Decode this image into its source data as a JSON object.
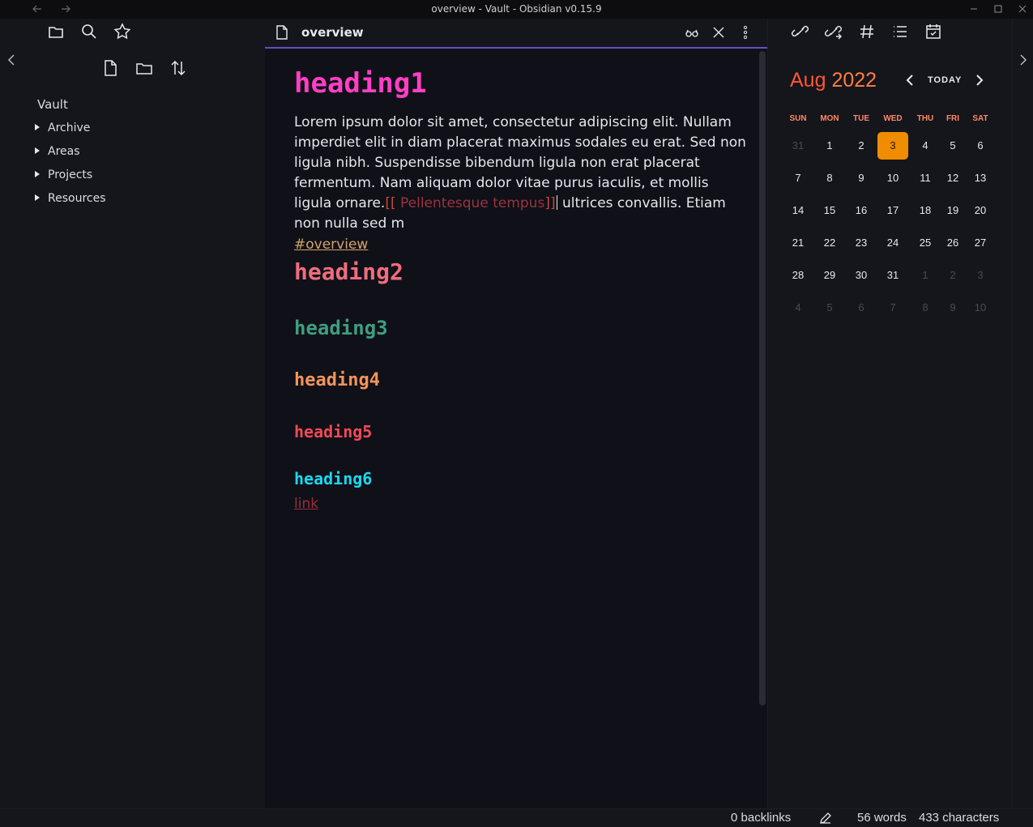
{
  "window": {
    "title": "overview - Vault - Obsidian v0.15.9"
  },
  "sidebar": {
    "vault_name": "Vault",
    "folders": [
      {
        "label": "Archive"
      },
      {
        "label": "Areas"
      },
      {
        "label": "Projects"
      },
      {
        "label": "Resources"
      }
    ]
  },
  "editor": {
    "tab_title": "overview",
    "heading1": "heading1",
    "paragraph_before": "Lorem ipsum dolor sit amet, consectetur adipiscing elit. Nullam imperdiet elit in diam placerat maximus sodales eu erat. Sed non ligula nibh. Suspendisse bibendum ligula non erat placerat fermentum. Nam aliquam dolor vitae purus iaculis, et mollis ligula ornare.",
    "wikilink_open": "[[",
    "wikilink_text": " Pellentesque tempus",
    "wikilink_close": "]]",
    "paragraph_after": " ultrices convallis. Etiam non nulla sed m",
    "tag": "#overview",
    "heading2": "heading2",
    "heading3": "heading3",
    "heading4": "heading4",
    "heading5": "heading5",
    "heading6": "heading6",
    "link": "link"
  },
  "calendar": {
    "month": "Aug",
    "year": "2022",
    "today_label": "TODAY",
    "weekdays": [
      "SUN",
      "MON",
      "TUE",
      "WED",
      "THU",
      "FRI",
      "SAT"
    ],
    "weeks": [
      [
        "31",
        "1",
        "2",
        "3",
        "4",
        "5",
        "6"
      ],
      [
        "7",
        "8",
        "9",
        "10",
        "11",
        "12",
        "13"
      ],
      [
        "14",
        "15",
        "16",
        "17",
        "18",
        "19",
        "20"
      ],
      [
        "21",
        "22",
        "23",
        "24",
        "25",
        "26",
        "27"
      ],
      [
        "28",
        "29",
        "30",
        "31",
        "1",
        "2",
        "3"
      ],
      [
        "4",
        "5",
        "6",
        "7",
        "8",
        "9",
        "10"
      ]
    ],
    "outside_month": [
      [
        0,
        0
      ],
      [
        4,
        4
      ],
      [
        4,
        5
      ],
      [
        4,
        6
      ],
      [
        5,
        0
      ],
      [
        5,
        1
      ],
      [
        5,
        2
      ],
      [
        5,
        3
      ],
      [
        5,
        4
      ],
      [
        5,
        5
      ],
      [
        5,
        6
      ]
    ],
    "today": [
      0,
      3
    ],
    "colors": {
      "today_bg": "#f08c00",
      "month": "#ff5733",
      "weekday": "#ff8a64"
    }
  },
  "statusbar": {
    "backlinks": "0 backlinks",
    "words": "56 words",
    "characters": "433 characters"
  }
}
